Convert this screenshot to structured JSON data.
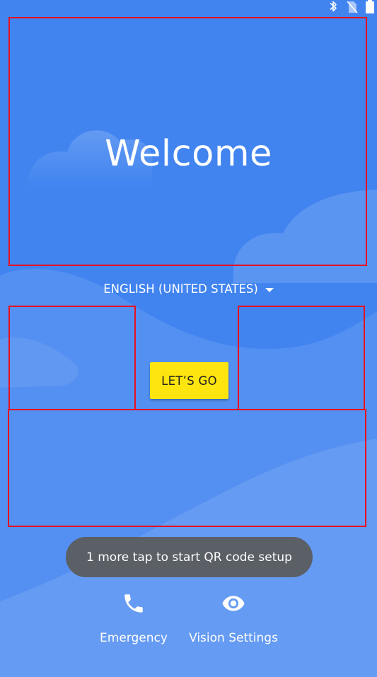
{
  "colors": {
    "background": "#4184f0",
    "accent_button": "#ffe50f",
    "toast_background": "#5b5f66",
    "annotation_box": "#e8101e"
  },
  "status_bar": {
    "icons": [
      "bluetooth-icon",
      "no-sim-icon",
      "battery-icon"
    ]
  },
  "welcome": {
    "title": "Welcome"
  },
  "language": {
    "selected": "ENGLISH (UNITED STATES)",
    "icon": "dropdown-caret-icon"
  },
  "primary_action": {
    "label": "LET’S GO"
  },
  "toast": {
    "message": "1 more tap to start QR code setup"
  },
  "bottom_actions": [
    {
      "label": "Emergency",
      "icon": "phone-icon"
    },
    {
      "label": "Vision Settings",
      "icon": "eye-icon"
    }
  ]
}
